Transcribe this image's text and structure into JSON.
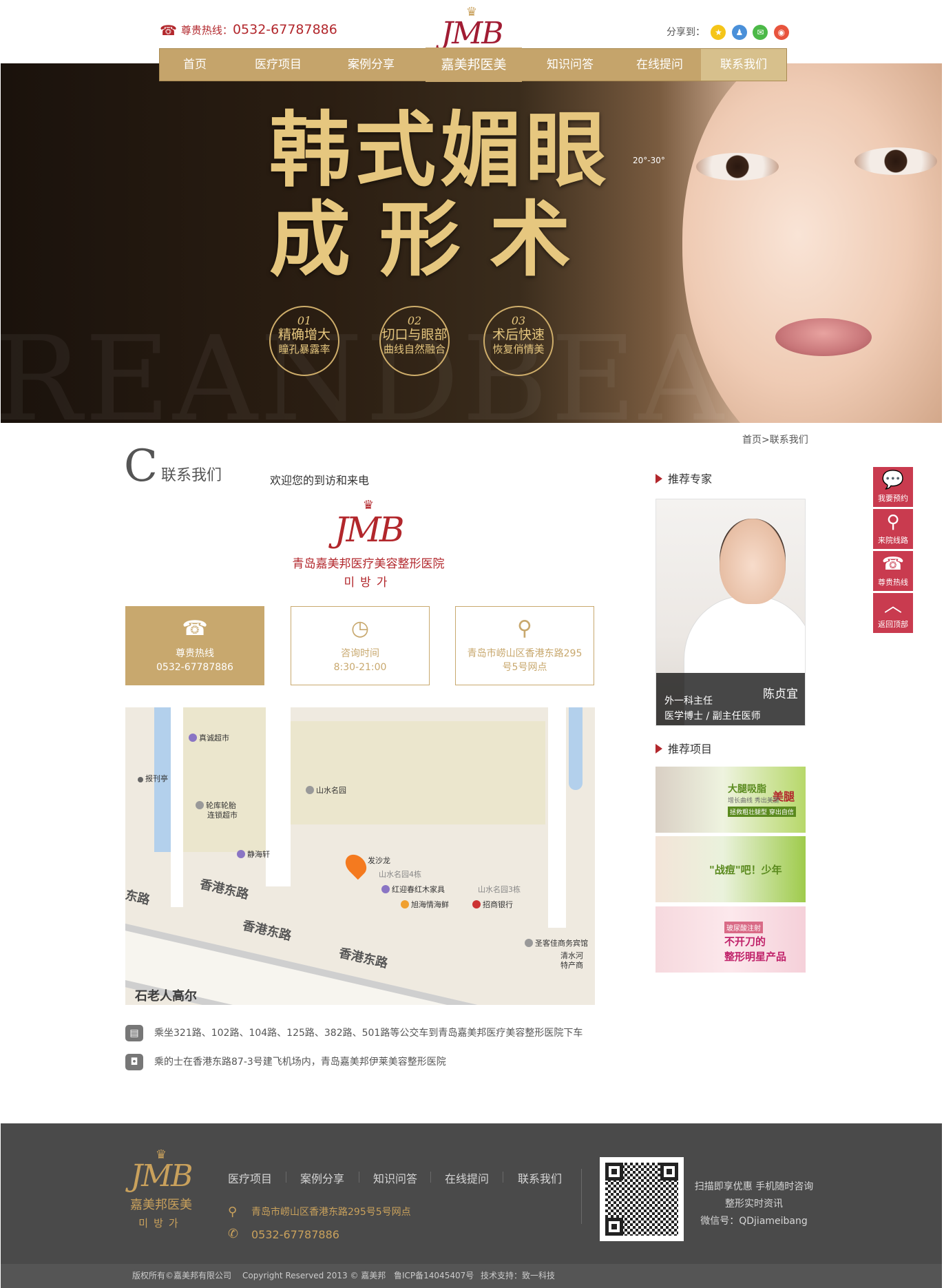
{
  "header": {
    "hotline_label": "尊贵热线：",
    "hotline_number": "0532-67787886",
    "logo_text": "JMB",
    "logo_cn": "嘉美邦医美",
    "share_label": "分享到："
  },
  "nav": {
    "items": [
      "首页",
      "医疗项目",
      "案例分享",
      "知识问答",
      "在线提问",
      "联系我们"
    ],
    "active": "联系我们"
  },
  "banner": {
    "title_line1": "韩式媚眼",
    "title_line2": "成形术",
    "bg_text": "REANDBEA",
    "angle_label": "20°-30°",
    "features": [
      {
        "num": "01",
        "line1": "精确增大",
        "line2": "瞳孔暴露率"
      },
      {
        "num": "02",
        "line1": "切口与眼部",
        "line2": "曲线自然融合"
      },
      {
        "num": "03",
        "line1": "术后快速",
        "line2": "恢复俏情美"
      }
    ]
  },
  "breadcrumb": {
    "home": "首页",
    "sep": ">",
    "current": "联系我们"
  },
  "contact": {
    "letter": "C",
    "title": "联系我们",
    "subtitle": "欢迎您的到访和来电",
    "logo_text": "JMB",
    "hospital_cn": "青岛嘉美邦医疗美容整形医院",
    "hospital_kr": "미방가",
    "boxes": [
      {
        "label": "尊贵热线",
        "value": "0532-67787886"
      },
      {
        "label": "咨询时间",
        "value": "8:30-21:00"
      },
      {
        "label": "青岛市崂山区香港东路295",
        "value": "号5号网点"
      }
    ],
    "routes": [
      "乘坐321路、102路、104路、125路、382路、501路等公交车到青岛嘉美邦医疗美容整形医院下车",
      "乘的士在香港东路87-3号建飞机场内，青岛嘉美邦伊莱美容整形医院"
    ]
  },
  "map": {
    "pois": [
      "真诚超市",
      "报刊亭",
      "轮库轮胎",
      "连锁超市",
      "山水名园",
      "静海轩",
      "发沙龙",
      "山水名园4栋",
      "红迎春红木家具",
      "旭海情海鲜",
      "招商银行",
      "山水名园3栋",
      "圣客佳商务宾馆",
      "清水河",
      "特产商",
      "石老人高尔"
    ],
    "roads": [
      "香港东路",
      "香港东路",
      "香港东路",
      "东路"
    ]
  },
  "sidebar": {
    "expert_heading": "推荐专家",
    "expert": {
      "name": "陈贞宜",
      "title": "外一科主任",
      "degree": "医学博士 / 副主任医师"
    },
    "project_heading": "推荐项目",
    "projects": [
      {
        "main": "大腿吸脂",
        "accent": "美腿",
        "sub": "增长曲线 秀出美腿",
        "tag": "拯救粗壮腿型 穿出自信"
      },
      {
        "main": "\"战痘\"吧！少年",
        "accent": "",
        "sub": "",
        "tag": ""
      },
      {
        "main": "不开刀的",
        "accent": "整形明星产品",
        "sub": "玻尿酸注射",
        "tag": ""
      }
    ]
  },
  "float_bar": {
    "items": [
      "我要预约",
      "来院线路",
      "尊贵热线",
      "返回顶部"
    ]
  },
  "footer": {
    "logo_text": "JMB",
    "logo_cn": "嘉美邦医美",
    "logo_kr": "미방가",
    "nav": [
      "医疗项目",
      "案例分享",
      "知识问答",
      "在线提问",
      "联系我们"
    ],
    "address": "青岛市崂山区香港东路295号5号网点",
    "phone": "0532-67787886",
    "qr_lines": [
      "扫描即享优惠 手机随时咨询",
      "整形实时资讯",
      "微信号：QDjiameibang"
    ],
    "copyright": [
      "版权所有©嘉美邦有限公司",
      "Copyright Reserved 2013 © 嘉美邦",
      "鲁ICP备14045407号",
      "技术支持：致一科技"
    ]
  },
  "colors": {
    "gold": "#c8a86e",
    "brand_red": "#b2272c",
    "float_red": "#c93b4f",
    "footer_bg": "#4a4a4a"
  }
}
